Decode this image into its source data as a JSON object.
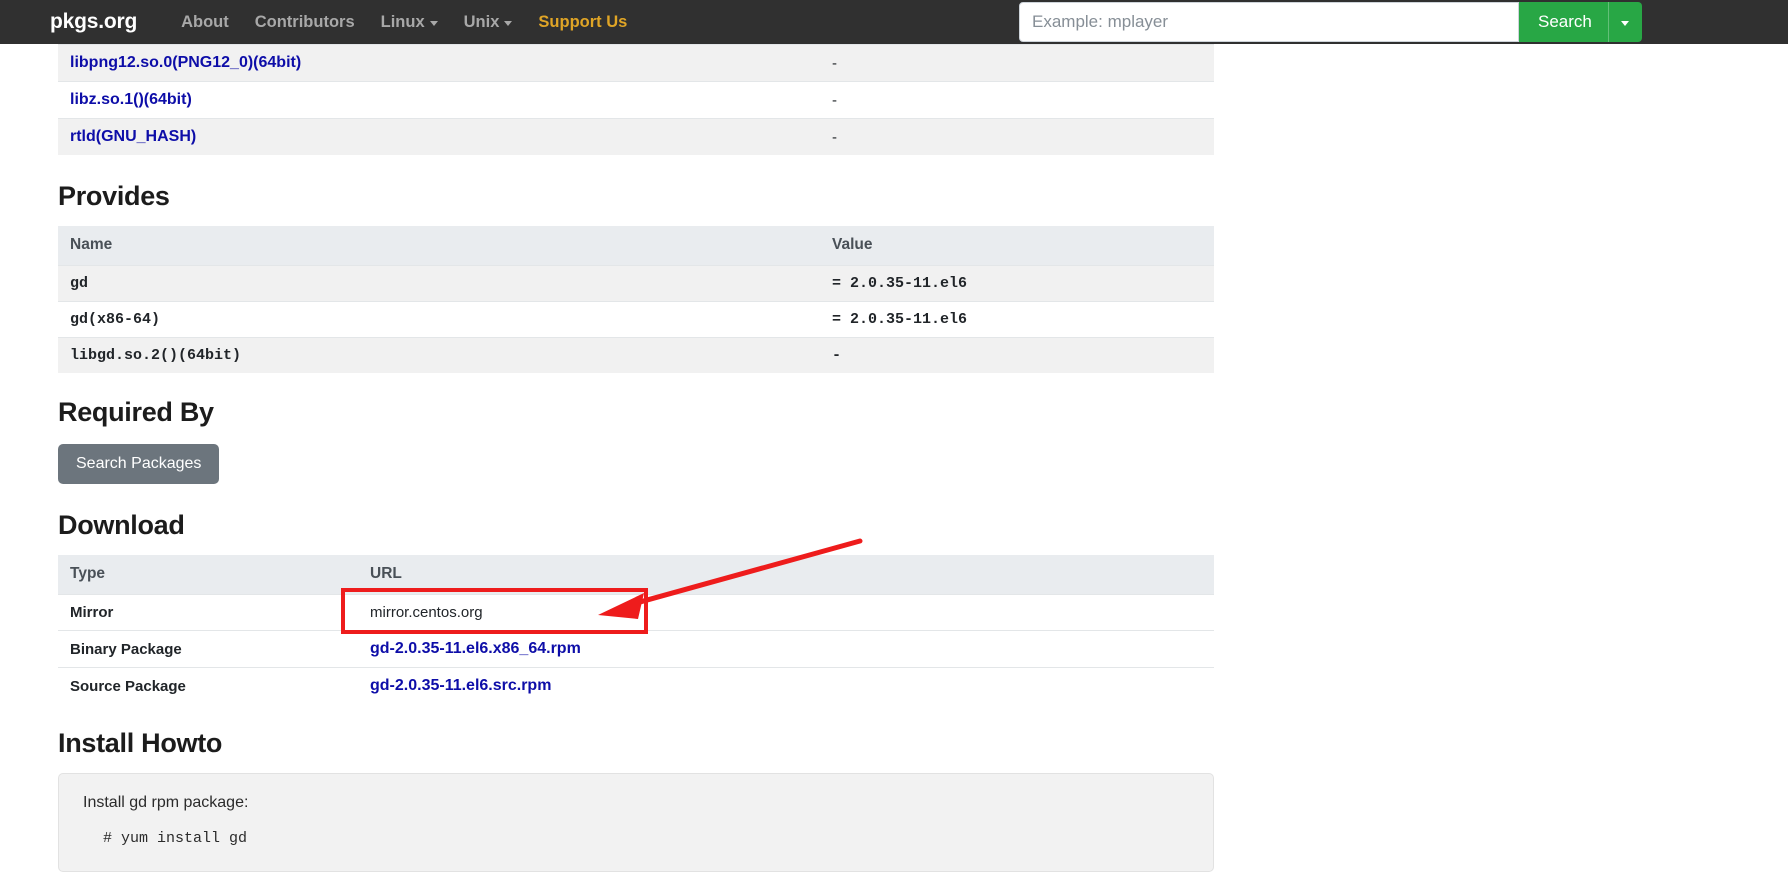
{
  "navbar": {
    "brand": "pkgs.org",
    "links": [
      {
        "label": "About",
        "has_caret": false,
        "accent": false
      },
      {
        "label": "Contributors",
        "has_caret": false,
        "accent": false
      },
      {
        "label": "Linux",
        "has_caret": true,
        "accent": false
      },
      {
        "label": "Unix",
        "has_caret": true,
        "accent": false
      },
      {
        "label": "Support Us",
        "has_caret": false,
        "accent": true
      }
    ],
    "search": {
      "placeholder": "Example: mplayer",
      "value": "",
      "button_label": "Search",
      "dropdown_icon": "chevron-down-icon"
    },
    "background_color": "#303030",
    "accent_color": "#e0a526",
    "search_button_color": "#28a745"
  },
  "requires_table": {
    "rows": [
      {
        "name": "libpng12.so.0(PNG12_0)(64bit)",
        "value": "-"
      },
      {
        "name": "libz.so.1()(64bit)",
        "value": "-"
      },
      {
        "name": "rtld(GNU_HASH)",
        "value": "-"
      }
    ]
  },
  "provides": {
    "title": "Provides",
    "headers": [
      "Name",
      "Value"
    ],
    "rows": [
      {
        "name": "gd",
        "value": "= 2.0.35-11.el6"
      },
      {
        "name": "gd(x86-64)",
        "value": "= 2.0.35-11.el6"
      },
      {
        "name": "libgd.so.2()(64bit)",
        "value": "-"
      }
    ]
  },
  "required_by": {
    "title": "Required By",
    "button_label": "Search Packages"
  },
  "download": {
    "title": "Download",
    "headers": [
      "Type",
      "URL"
    ],
    "rows": [
      {
        "type": "Mirror",
        "url": "mirror.centos.org",
        "is_link": false
      },
      {
        "type": "Binary Package",
        "url": "gd-2.0.35-11.el6.x86_64.rpm",
        "is_link": true
      },
      {
        "type": "Source Package",
        "url": "gd-2.0.35-11.el6.src.rpm",
        "is_link": true
      }
    ]
  },
  "install_howto": {
    "title": "Install Howto",
    "description": "Install gd rpm package:",
    "command": "# yum install gd"
  },
  "annotations": {
    "highlight_color": "#ee1c1c",
    "highlight_target": "gd-2.0.35-11.el6.x86_64.rpm",
    "arrow_direction": "down-left"
  }
}
